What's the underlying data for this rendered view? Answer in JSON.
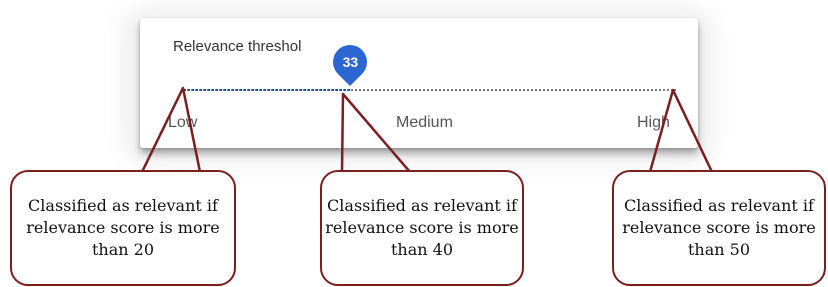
{
  "slider": {
    "title": "Relevance threshol",
    "value": 33,
    "value_label": "33",
    "labels": {
      "low": "Low",
      "medium": "Medium",
      "high": "High"
    }
  },
  "callouts": [
    {
      "text": "Classified as relevant if relevance score is more than 20"
    },
    {
      "text": "Classified as relevant if relevance score is more than 40"
    },
    {
      "text": "Classified as relevant if relevance score is more than 50"
    }
  ],
  "colors": {
    "accent": "#2b66d3",
    "callout_border": "#7b1e1e",
    "track": "#7a7a7a"
  }
}
